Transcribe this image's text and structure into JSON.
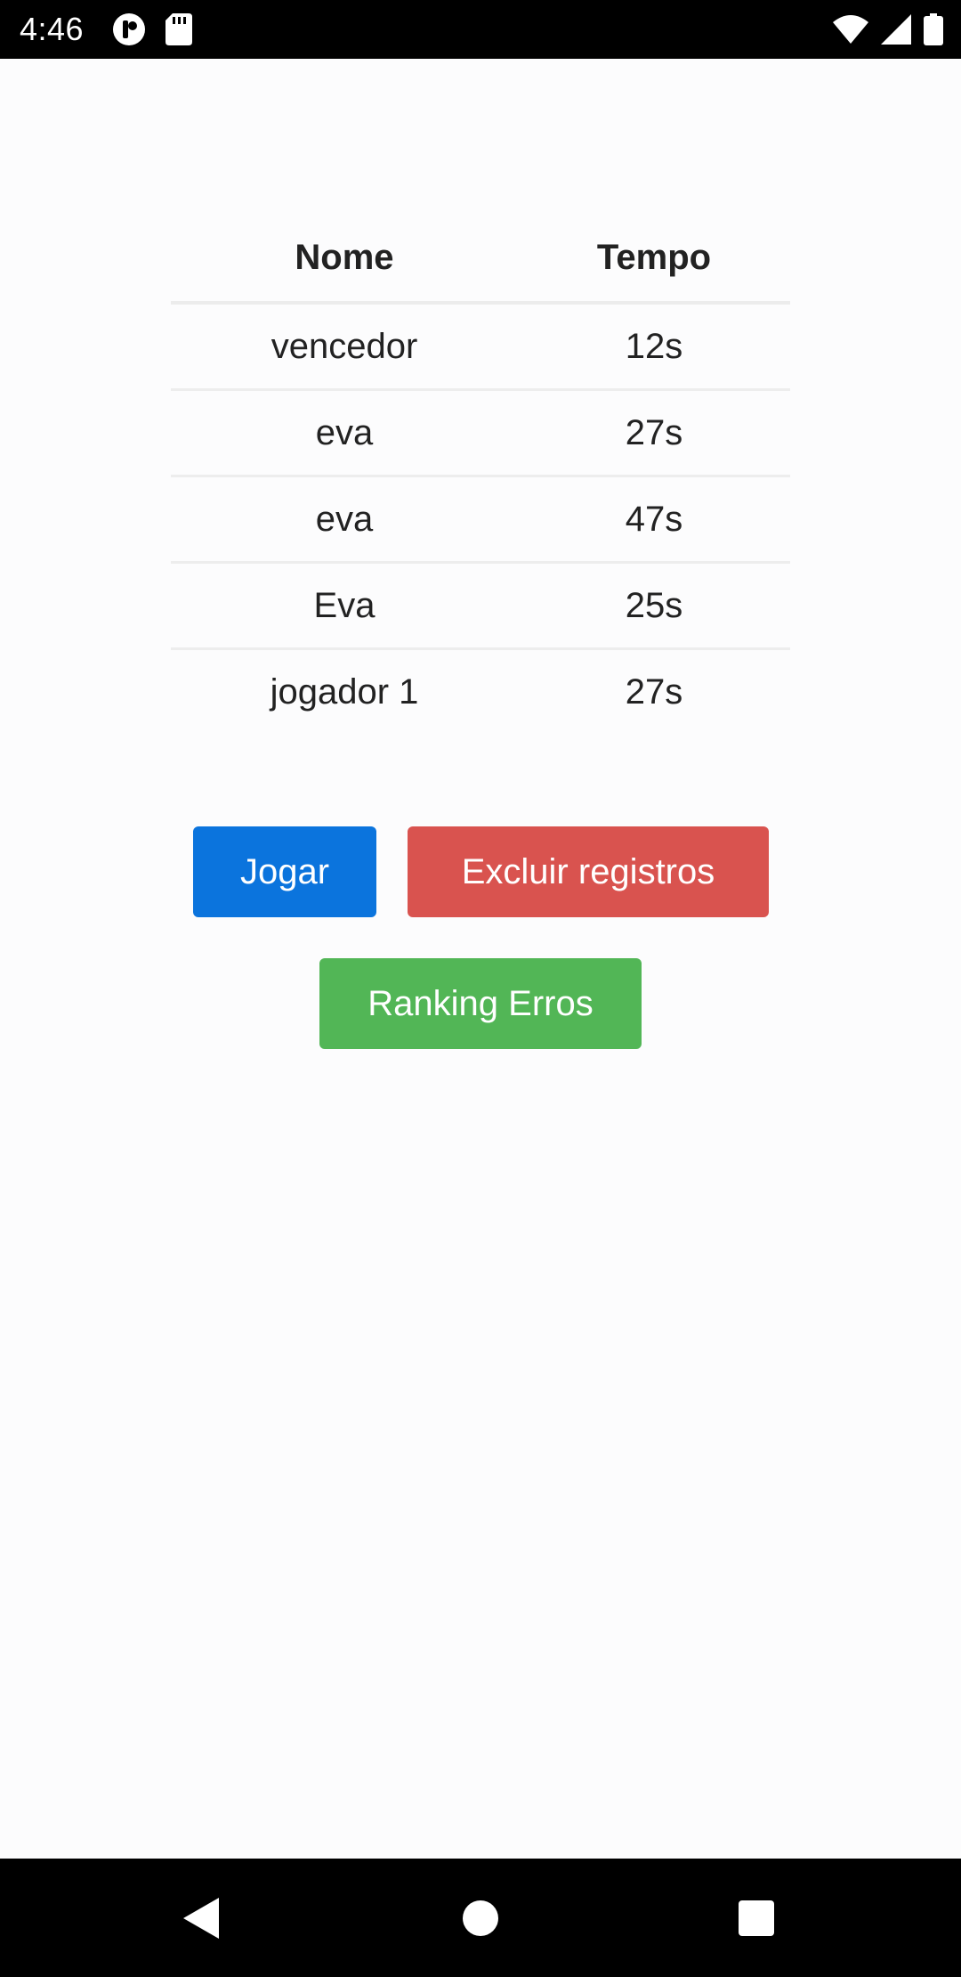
{
  "status_bar": {
    "time": "4:46",
    "left_icons": [
      "notification-app-icon",
      "sd-card-icon"
    ],
    "right_icons": [
      "wifi-icon",
      "cell-signal-icon",
      "battery-icon"
    ]
  },
  "ranking": {
    "headers": {
      "nome": "Nome",
      "tempo": "Tempo"
    },
    "rows": [
      {
        "nome": "vencedor",
        "tempo": "12s"
      },
      {
        "nome": "eva",
        "tempo": "27s"
      },
      {
        "nome": "eva",
        "tempo": "47s"
      },
      {
        "nome": "Eva",
        "tempo": "25s"
      },
      {
        "nome": "jogador 1",
        "tempo": "27s"
      }
    ]
  },
  "buttons": {
    "jogar": {
      "label": "Jogar",
      "color": "#0b74dd"
    },
    "excluir": {
      "label": "Excluir registros",
      "color": "#d9534f"
    },
    "ranking_erros": {
      "label": "Ranking Erros",
      "color": "#52b656"
    }
  },
  "nav_bar": {
    "icons": [
      "back-icon",
      "home-icon",
      "recents-icon"
    ]
  }
}
